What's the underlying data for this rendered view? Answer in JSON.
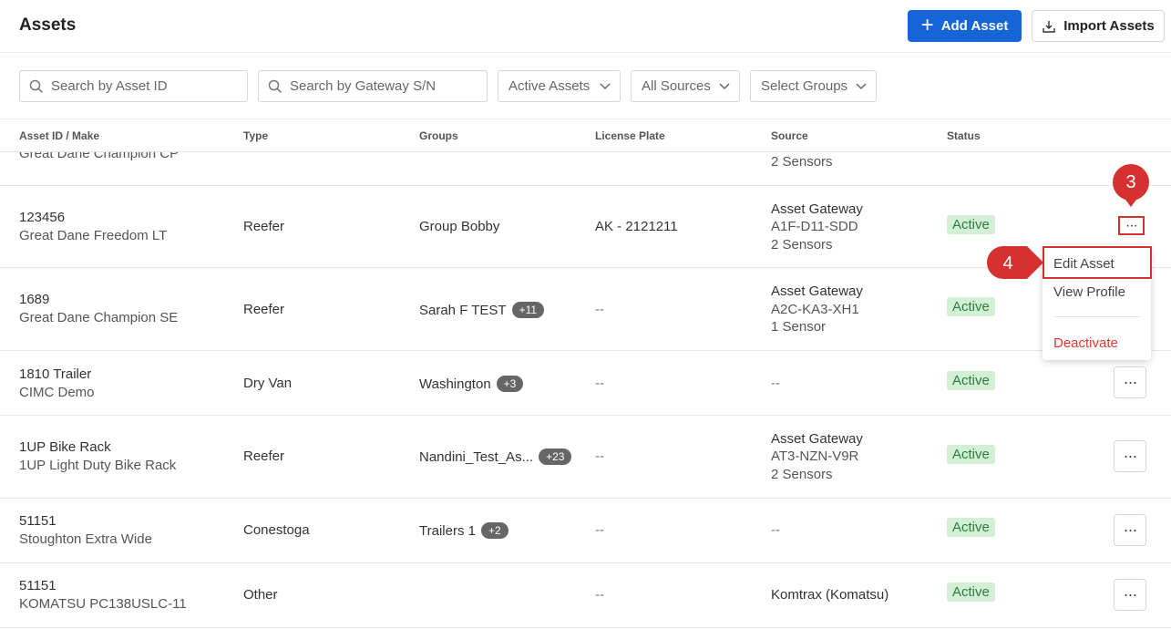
{
  "header": {
    "title": "Assets",
    "add_label": "Add Asset",
    "import_label": "Import Assets"
  },
  "filters": {
    "asset_search_placeholder": "Search by Asset ID",
    "gateway_search_placeholder": "Search by Gateway S/N",
    "status_select": "Active Assets",
    "source_select": "All Sources",
    "groups_select": "Select Groups"
  },
  "table": {
    "headers": [
      "Asset ID / Make",
      "Type",
      "Groups",
      "License Plate",
      "Source",
      "Status"
    ],
    "partial_row": {
      "make": "Great Dane Champion CP",
      "source_line3": "2 Sensors"
    },
    "rows": [
      {
        "id": "123456",
        "make": "Great Dane Freedom LT",
        "type": "Reefer",
        "group": "Group Bobby",
        "group_count": "",
        "plate": "AK - 2121211",
        "source": [
          "Asset Gateway",
          "A1F-D11-SDD",
          "2 Sensors"
        ],
        "status": "Active"
      },
      {
        "id": "1689",
        "make": "Great Dane Champion SE",
        "type": "Reefer",
        "group": "Sarah F TEST",
        "group_count": "+11",
        "plate": "--",
        "source": [
          "Asset Gateway",
          "A2C-KA3-XH1",
          "1 Sensor"
        ],
        "status": "Active"
      },
      {
        "id": "1810 Trailer",
        "make": "CIMC Demo",
        "type": "Dry Van",
        "group": "Washington",
        "group_count": "+3",
        "plate": "--",
        "source": [
          "--"
        ],
        "status": "Active"
      },
      {
        "id": "1UP Bike Rack",
        "make": "1UP Light Duty Bike Rack",
        "type": "Reefer",
        "group": "Nandini_Test_As...",
        "group_count": "+23",
        "plate": "--",
        "source": [
          "Asset Gateway",
          "AT3-NZN-V9R",
          "2 Sensors"
        ],
        "status": "Active"
      },
      {
        "id": "51151",
        "make": "Stoughton Extra Wide",
        "type": "Conestoga",
        "group": "Trailers 1",
        "group_count": "+2",
        "plate": "--",
        "source": [
          "--"
        ],
        "status": "Active"
      },
      {
        "id": "51151",
        "make": "KOMATSU PC138USLC-11",
        "type": "Other",
        "group": "--",
        "group_count": "",
        "plate": "",
        "source": [
          "Komtrax (Komatsu)"
        ],
        "status": "Active"
      }
    ]
  },
  "menu": {
    "edit": "Edit Asset",
    "view": "View Profile",
    "deactivate": "Deactivate"
  },
  "annotations": {
    "step3": "3",
    "step4": "4"
  },
  "colors": {
    "primary": "#1565d8",
    "annotation": "#d63131",
    "active_bg": "#d3f0d6",
    "active_text": "#2e7d3e",
    "danger": "#e53935"
  }
}
